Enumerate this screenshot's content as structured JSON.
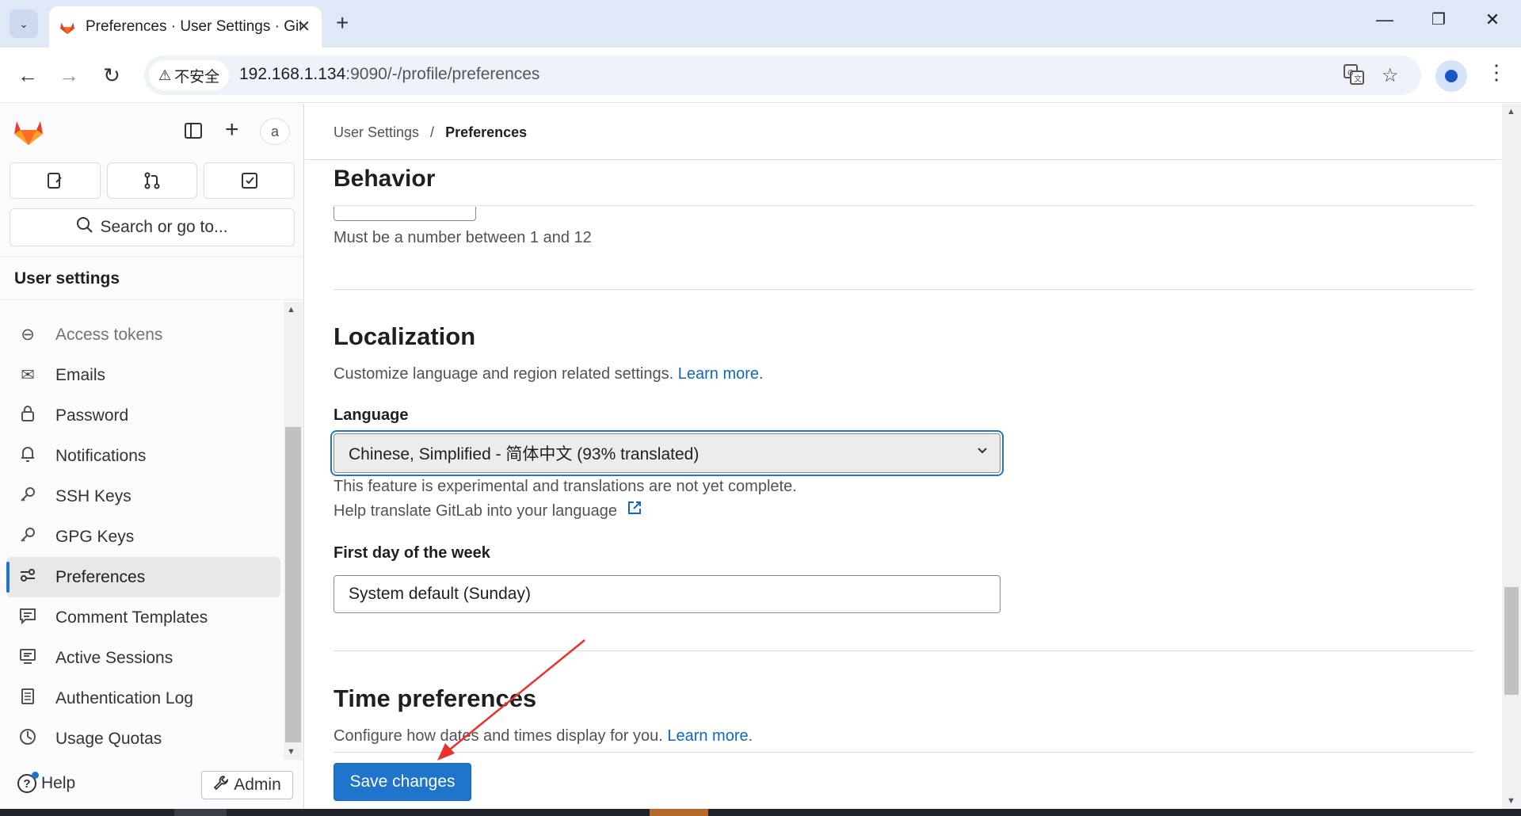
{
  "browser": {
    "tab_title": "Preferences · User Settings · GitLab",
    "security_label": "不安全",
    "url_host": "192.168.1.134",
    "url_rest": ":9090/-/profile/preferences"
  },
  "sidebar": {
    "avatar_alt": "a",
    "search_placeholder": "Search or go to...",
    "heading": "User settings",
    "items": [
      {
        "label": "Access tokens",
        "icon": "token-icon"
      },
      {
        "label": "Emails",
        "icon": "mail-icon"
      },
      {
        "label": "Password",
        "icon": "lock-icon"
      },
      {
        "label": "Notifications",
        "icon": "bell-icon"
      },
      {
        "label": "SSH Keys",
        "icon": "key-icon"
      },
      {
        "label": "GPG Keys",
        "icon": "key-icon"
      },
      {
        "label": "Preferences",
        "icon": "preferences-icon",
        "active": true
      },
      {
        "label": "Comment Templates",
        "icon": "comment-icon"
      },
      {
        "label": "Active Sessions",
        "icon": "monitor-icon"
      },
      {
        "label": "Authentication Log",
        "icon": "log-icon"
      },
      {
        "label": "Usage Quotas",
        "icon": "quota-icon"
      }
    ],
    "help_label": "Help",
    "admin_label": "Admin"
  },
  "breadcrumb": {
    "parent": "User Settings",
    "separator": "/",
    "current": "Preferences"
  },
  "behavior": {
    "sticky_title": "Behavior",
    "hint": "Must be a number between 1 and 12"
  },
  "localization": {
    "title": "Localization",
    "description": "Customize language and region related settings.",
    "learn_more": "Learn more",
    "language_label": "Language",
    "language_value": "Chinese, Simplified - 简体中文 (93% translated)",
    "experimental_note": "This feature is experimental and translations are not yet complete.",
    "help_translate": "Help translate GitLab into your language",
    "first_day_label": "First day of the week",
    "first_day_value": "System default (Sunday)"
  },
  "time_preferences": {
    "title": "Time preferences",
    "description": "Configure how dates and times display for you.",
    "learn_more": "Learn more"
  },
  "save_button": "Save changes",
  "colors": {
    "primary": "#1f75cb",
    "link": "#1068bf",
    "annotation_arrow": "#e8322a"
  }
}
